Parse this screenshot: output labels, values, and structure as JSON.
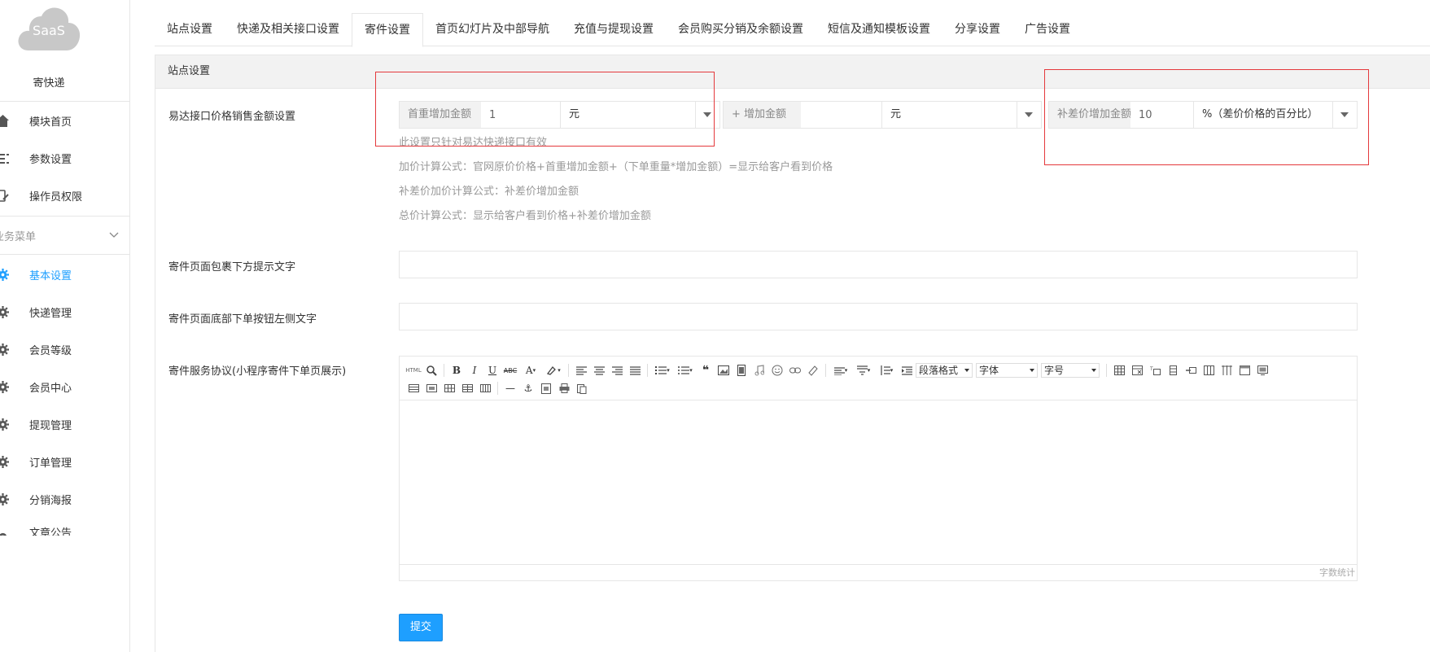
{
  "sidebar": {
    "logo_text": "SaaS",
    "app_name": "寄快递",
    "top_items": [
      {
        "label": "模块首页",
        "icon": "home-icon"
      },
      {
        "label": "参数设置",
        "icon": "list-settings-icon"
      },
      {
        "label": "操作员权限",
        "icon": "operator-icon"
      }
    ],
    "group_label": "业务菜单",
    "menu_items": [
      {
        "label": "基本设置",
        "icon": "gear-icon",
        "active": true
      },
      {
        "label": "快递管理",
        "icon": "gear-icon"
      },
      {
        "label": "会员等级",
        "icon": "gear-icon"
      },
      {
        "label": "会员中心",
        "icon": "gear-icon"
      },
      {
        "label": "提现管理",
        "icon": "gear-icon"
      },
      {
        "label": "订单管理",
        "icon": "gear-icon"
      },
      {
        "label": "分销海报",
        "icon": "gear-icon"
      },
      {
        "label": "文章公告",
        "icon": "gear-icon"
      }
    ]
  },
  "tabs": [
    {
      "label": "站点设置"
    },
    {
      "label": "快递及相关接口设置"
    },
    {
      "label": "寄件设置",
      "active": true
    },
    {
      "label": "首页幻灯片及中部导航"
    },
    {
      "label": "充值与提现设置"
    },
    {
      "label": "会员购买分销及余额设置"
    },
    {
      "label": "短信及通知模板设置"
    },
    {
      "label": "分享设置"
    },
    {
      "label": "广告设置"
    }
  ],
  "panel": {
    "title": "站点设置",
    "price_row": {
      "label": "易达接口价格销售金额设置",
      "first_weight": {
        "addon": "首重增加金额",
        "value": "1",
        "unit": "元"
      },
      "extra_weight": {
        "addon": "+ 增加金额",
        "value": "",
        "unit": "元"
      },
      "diff_price": {
        "addon": "补差价增加金额",
        "value": "10",
        "unit": "%（差价价格的百分比）"
      },
      "help": [
        "此设置只针对易达快递接口有效",
        "加价计算公式：官网原价价格+首重增加金额+（下单重量*增加金额）=显示给客户看到价格",
        "补差价加价计算公式：补差价增加金额",
        "总价计算公式：显示给客户看到价格+补差价增加金额"
      ]
    },
    "package_tip_label": "寄件页面包裹下方提示文字",
    "package_tip_value": "",
    "button_left_label": "寄件页面底部下单按钮左侧文字",
    "button_left_value": "",
    "agreement_label": "寄件服务协议(小程序寄件下单页展示)",
    "editor": {
      "combo_paragraph": "段落格式",
      "combo_font": "字体",
      "combo_size": "字号",
      "word_count_label": "字数统计",
      "toolbar_glyphs": {
        "html": "HTML",
        "bold": "B",
        "italic": "I",
        "underline": "U",
        "strike": "ABC",
        "font_color": "A",
        "quote": "❝",
        "hr": "—",
        "anchor": "⚓"
      }
    },
    "submit_label": "提交"
  },
  "colors": {
    "accent": "#1e9fff",
    "highlight_box": "#e4393c",
    "addon_bg": "#f2f2f2",
    "border": "#e6e6e6"
  }
}
